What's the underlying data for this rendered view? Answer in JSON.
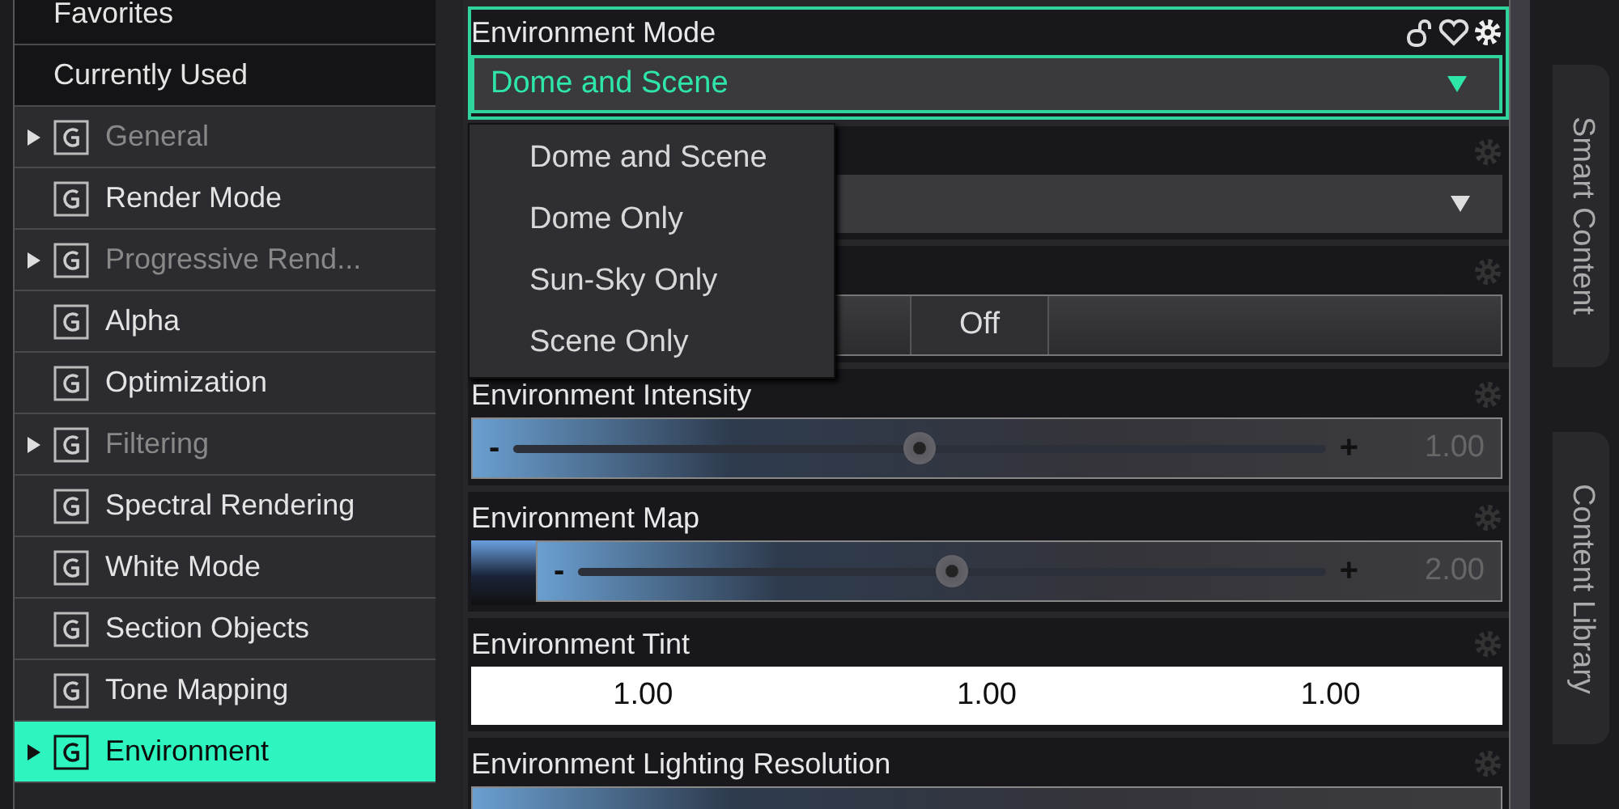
{
  "sidebar": {
    "items": [
      {
        "label": "Favorites",
        "kind": "category",
        "disabled": false,
        "selected": false
      },
      {
        "label": "Currently Used",
        "kind": "category",
        "disabled": false,
        "selected": false
      },
      {
        "label": "General",
        "kind": "group",
        "expandable": true,
        "disabled": true,
        "selected": false
      },
      {
        "label": "Render Mode",
        "kind": "group",
        "expandable": false,
        "disabled": false,
        "selected": false
      },
      {
        "label": "Progressive Rend...",
        "kind": "group",
        "expandable": true,
        "disabled": true,
        "selected": false
      },
      {
        "label": "Alpha",
        "kind": "group",
        "expandable": false,
        "disabled": false,
        "selected": false
      },
      {
        "label": "Optimization",
        "kind": "group",
        "expandable": false,
        "disabled": false,
        "selected": false
      },
      {
        "label": "Filtering",
        "kind": "group",
        "expandable": true,
        "disabled": true,
        "selected": false
      },
      {
        "label": "Spectral Rendering",
        "kind": "group",
        "expandable": false,
        "disabled": false,
        "selected": false
      },
      {
        "label": "White Mode",
        "kind": "group",
        "expandable": false,
        "disabled": false,
        "selected": false
      },
      {
        "label": "Section Objects",
        "kind": "group",
        "expandable": false,
        "disabled": false,
        "selected": false
      },
      {
        "label": "Tone Mapping",
        "kind": "group",
        "expandable": false,
        "disabled": false,
        "selected": false
      },
      {
        "label": "Environment",
        "kind": "group",
        "expandable": true,
        "disabled": false,
        "selected": true
      }
    ]
  },
  "properties": [
    {
      "kind": "dropdown",
      "label": "Environment Mode",
      "value": "Dome and Scene",
      "highlighted": true
    },
    {
      "kind": "dropdown",
      "highlighted": false
    },
    {
      "kind": "toggle",
      "button_label": "Off",
      "highlighted": false
    },
    {
      "kind": "slider",
      "label": "Environment Intensity",
      "level": 0.5,
      "minus": "-",
      "plus": "+",
      "reading": "1.00",
      "highlighted": false
    },
    {
      "kind": "map-slider",
      "label": "Environment Map",
      "level": 0.5,
      "minus": "-",
      "plus": "+",
      "reading": "2.00",
      "highlighted": false
    },
    {
      "kind": "color",
      "label": "Environment Tint",
      "values": [
        "1.00",
        "1.00",
        "1.00"
      ],
      "highlighted": false
    },
    {
      "kind": "slider",
      "label": "Environment Lighting Resolution",
      "highlighted": false
    }
  ],
  "dropdown_menu": {
    "options": [
      "Dome and Scene",
      "Dome Only",
      "Sun-Sky Only",
      "Scene Only"
    ]
  },
  "side_tabs": [
    {
      "label": "Smart Content"
    },
    {
      "label": "Content Library"
    }
  ]
}
